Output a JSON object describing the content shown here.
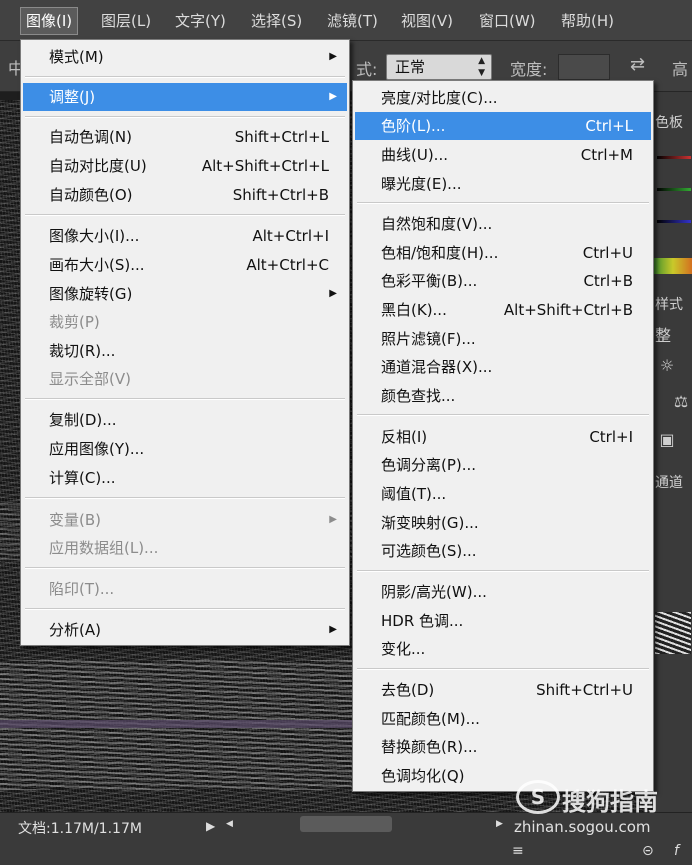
{
  "menubar": {
    "items": [
      {
        "label": "图像(I)",
        "active": true
      },
      {
        "label": "图层(L)"
      },
      {
        "label": "文字(Y)"
      },
      {
        "label": "选择(S)"
      },
      {
        "label": "滤镜(T)"
      },
      {
        "label": "视图(V)"
      },
      {
        "label": "窗口(W)"
      },
      {
        "label": "帮助(H)"
      }
    ]
  },
  "options": {
    "left_fragment": "中",
    "style_label": "式:",
    "mode_value": "正常",
    "width_label": "宽度:",
    "height_fragment": "高"
  },
  "image_menu": {
    "items": [
      {
        "label": "模式(M)",
        "submenu": true
      },
      {
        "label": "调整(J)",
        "submenu": true,
        "highlighted": true
      },
      {
        "label": "自动色调(N)",
        "shortcut": "Shift+Ctrl+L"
      },
      {
        "label": "自动对比度(U)",
        "shortcut": "Alt+Shift+Ctrl+L"
      },
      {
        "label": "自动颜色(O)",
        "shortcut": "Shift+Ctrl+B"
      },
      {
        "label": "图像大小(I)...",
        "shortcut": "Alt+Ctrl+I"
      },
      {
        "label": "画布大小(S)...",
        "shortcut": "Alt+Ctrl+C"
      },
      {
        "label": "图像旋转(G)",
        "submenu": true
      },
      {
        "label": "裁剪(P)",
        "disabled": true
      },
      {
        "label": "裁切(R)..."
      },
      {
        "label": "显示全部(V)",
        "disabled": true
      },
      {
        "label": "复制(D)..."
      },
      {
        "label": "应用图像(Y)..."
      },
      {
        "label": "计算(C)..."
      },
      {
        "label": "变量(B)",
        "submenu": true,
        "disabled": true
      },
      {
        "label": "应用数据组(L)...",
        "disabled": true
      },
      {
        "label": "陷印(T)...",
        "disabled": true
      },
      {
        "label": "分析(A)",
        "submenu": true
      }
    ]
  },
  "adjust_menu": {
    "items": [
      {
        "label": "亮度/对比度(C)..."
      },
      {
        "label": "色阶(L)...",
        "shortcut": "Ctrl+L",
        "highlighted": true
      },
      {
        "label": "曲线(U)...",
        "shortcut": "Ctrl+M"
      },
      {
        "label": "曝光度(E)..."
      },
      {
        "label": "自然饱和度(V)..."
      },
      {
        "label": "色相/饱和度(H)...",
        "shortcut": "Ctrl+U"
      },
      {
        "label": "色彩平衡(B)...",
        "shortcut": "Ctrl+B"
      },
      {
        "label": "黑白(K)...",
        "shortcut": "Alt+Shift+Ctrl+B"
      },
      {
        "label": "照片滤镜(F)..."
      },
      {
        "label": "通道混合器(X)..."
      },
      {
        "label": "颜色查找..."
      },
      {
        "label": "反相(I)",
        "shortcut": "Ctrl+I"
      },
      {
        "label": "色调分离(P)..."
      },
      {
        "label": "阈值(T)..."
      },
      {
        "label": "渐变映射(G)..."
      },
      {
        "label": "可选颜色(S)..."
      },
      {
        "label": "阴影/高光(W)..."
      },
      {
        "label": "HDR 色调..."
      },
      {
        "label": "变化..."
      },
      {
        "label": "去色(D)",
        "shortcut": "Shift+Ctrl+U"
      },
      {
        "label": "匹配颜色(M)..."
      },
      {
        "label": "替换颜色(R)..."
      },
      {
        "label": "色调均化(Q)"
      }
    ]
  },
  "right_panel": {
    "tab_color": "色板",
    "label_styles": "样式",
    "label_adjust": "整",
    "label_channels": "通道"
  },
  "statusbar": {
    "doc_info": "文档:1.17M/1.17M"
  },
  "watermark": {
    "brand": "搜狗指南",
    "url": "zhinan.sogou.com"
  },
  "colors": {
    "menu_bg": "#f0f0f0",
    "highlight": "#3d8ee6",
    "chrome_dark": "#424242"
  }
}
